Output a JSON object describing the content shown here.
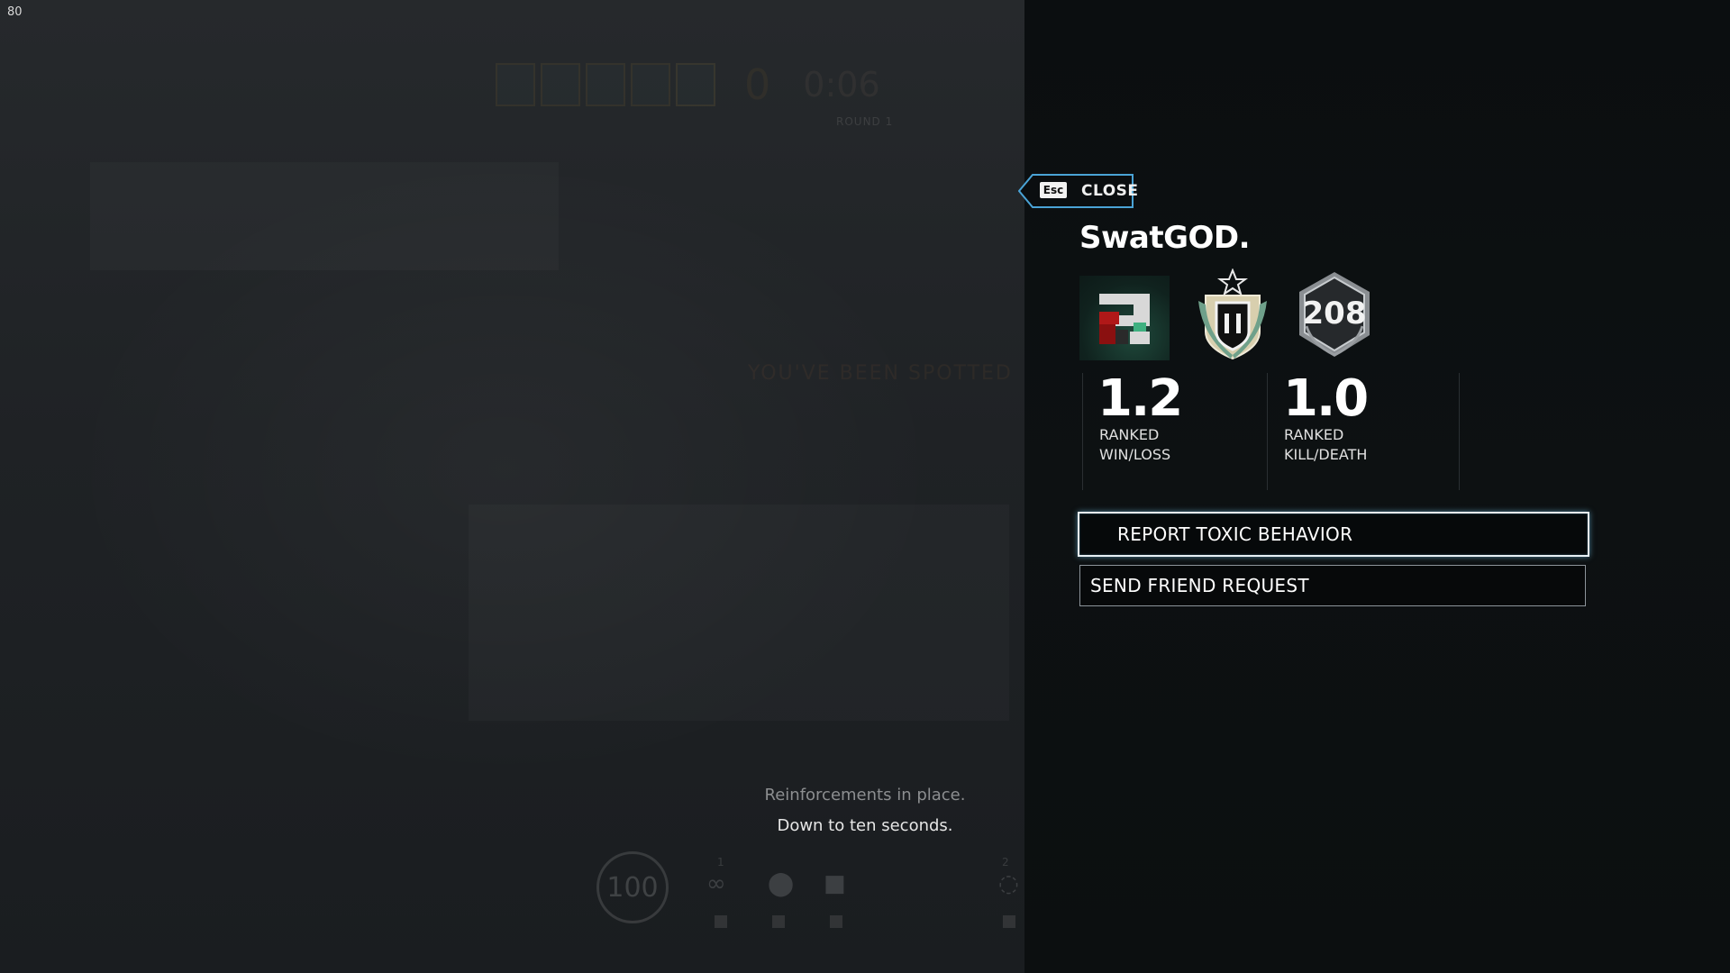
{
  "fps_counter": "80",
  "hud": {
    "score": "0",
    "timer": "0:06",
    "round_label": "ROUND 1",
    "banner_text": "YOU'VE BEEN SPOTTED",
    "health": "100",
    "gadget_slot_1_number": "1",
    "gadget_slot_2_number": "2"
  },
  "status": {
    "line1": "Reinforcements in place.",
    "line2": "Down to ten seconds."
  },
  "panel": {
    "close_key": "Esc",
    "close_label": "CLOSE",
    "player_name": "SwatGOD.",
    "level": "208",
    "rank_tier": "II",
    "stats": [
      {
        "value": "1.2",
        "label_line1": "RANKED",
        "label_line2": "WIN/LOSS"
      },
      {
        "value": "1.0",
        "label_line1": "RANKED",
        "label_line2": "KILL/DEATH"
      }
    ],
    "actions": {
      "report": "REPORT TOXIC BEHAVIOR",
      "friend": "SEND FRIEND REQUEST"
    }
  },
  "colors": {
    "panel_bg": "#0b0e10",
    "focus_glow": "#78c8f0",
    "tab_border": "#4aa3d6"
  }
}
